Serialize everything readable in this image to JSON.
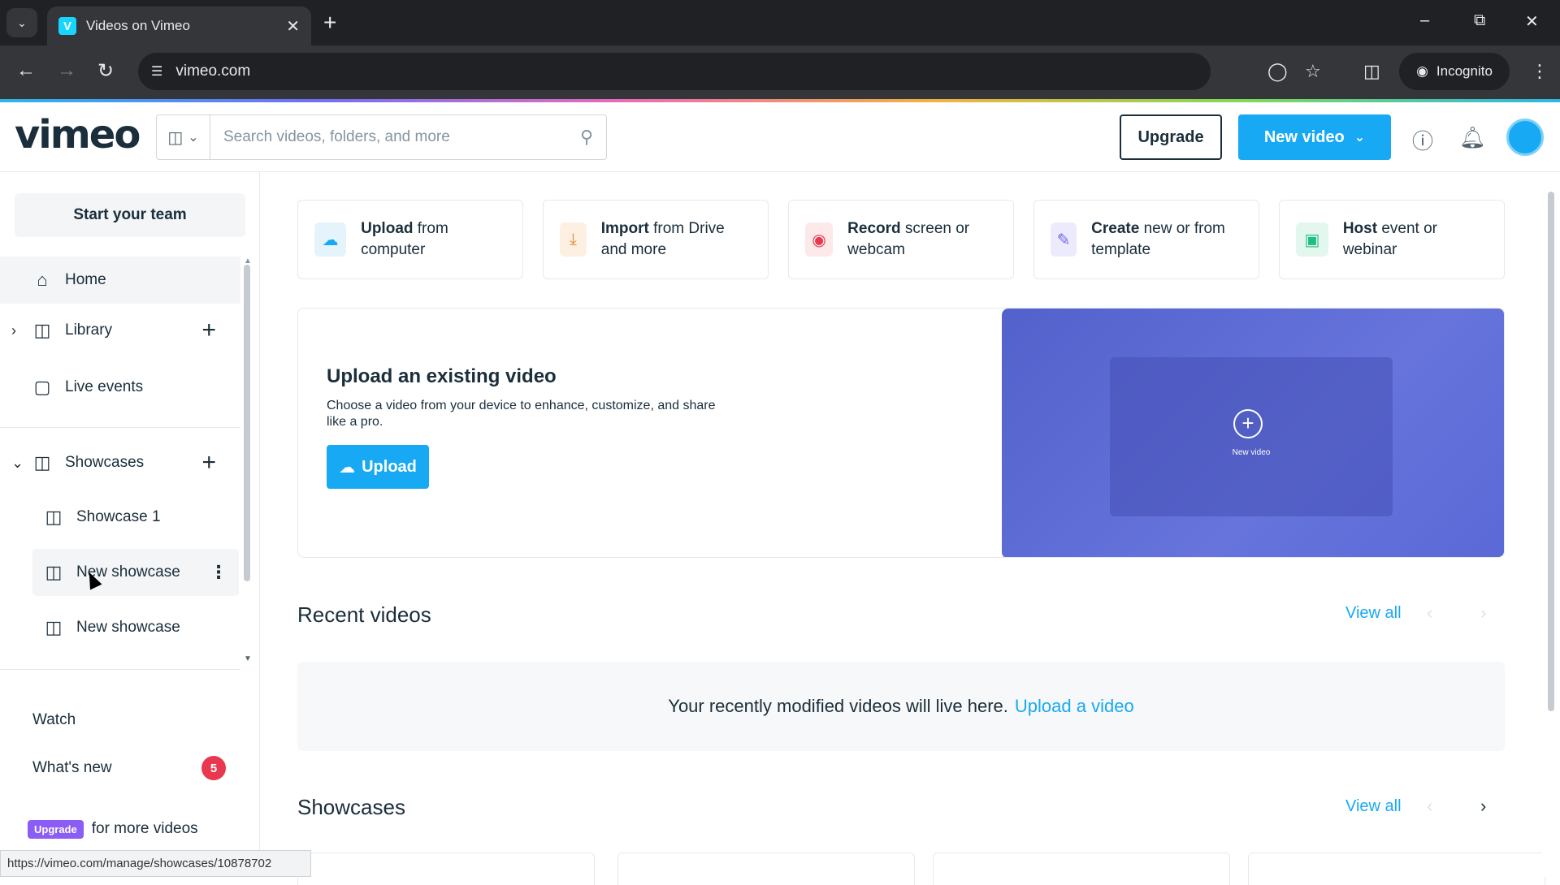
{
  "browser": {
    "tab_title": "Videos on Vimeo",
    "tab_favicon": "V",
    "url": "vimeo.com",
    "incognito_label": "Incognito",
    "status_url": "https://vimeo.com/manage/showcases/10878702"
  },
  "header": {
    "logo": "vimeo",
    "search_placeholder": "Search videos, folders, and more",
    "upgrade_label": "Upgrade",
    "new_video_label": "New video"
  },
  "sidebar": {
    "start_team": "Start your team",
    "home": "Home",
    "library": "Library",
    "live_events": "Live events",
    "showcases": "Showcases",
    "showcase_items": [
      "Showcase 1",
      "New showcase",
      "New showcase"
    ],
    "watch": "Watch",
    "whats_new": "What's new",
    "whats_new_count": "5",
    "upgrade_pill": "Upgrade",
    "upgrade_text": "for more videos"
  },
  "quick_actions": [
    {
      "bold": "Upload",
      "rest": " from computer",
      "icon": "cloud-upload-icon",
      "color": "#e5f4fb",
      "fg": "#17a9f3"
    },
    {
      "bold": "Import",
      "rest": " from Drive and more",
      "icon": "download-icon",
      "color": "#fdf0e3",
      "fg": "#e88a2c"
    },
    {
      "bold": "Record",
      "rest": " screen or webcam",
      "icon": "record-icon",
      "color": "#fde8ea",
      "fg": "#e8384f"
    },
    {
      "bold": "Create",
      "rest": " new or from template",
      "icon": "edit-icon",
      "color": "#ecebfd",
      "fg": "#6d65e8"
    },
    {
      "bold": "Host",
      "rest": " event or webinar",
      "icon": "camera-icon",
      "color": "#e3f7ef",
      "fg": "#1fbf7f"
    }
  ],
  "hero": {
    "title": "Upload an existing video",
    "description": "Choose a video from your device to enhance, customize, and share like a pro.",
    "button": "Upload",
    "art_label": "New video"
  },
  "recent": {
    "title": "Recent videos",
    "view_all": "View all",
    "empty_text": "Your recently modified videos will live here.",
    "empty_link": "Upload a video"
  },
  "showcases_section": {
    "title": "Showcases",
    "view_all": "View all"
  }
}
